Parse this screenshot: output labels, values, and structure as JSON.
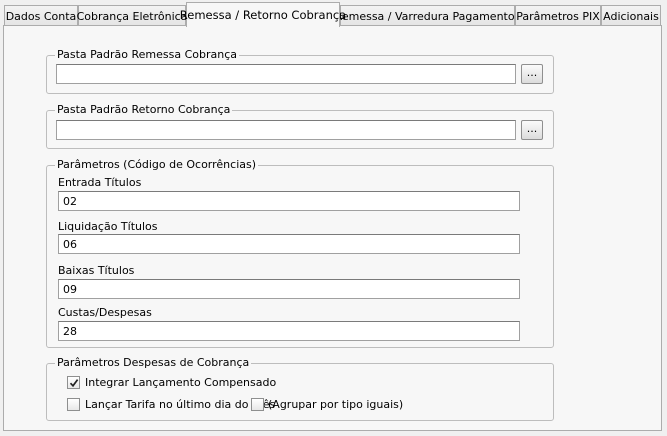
{
  "tabs": [
    {
      "label": "Dados Conta",
      "active": false
    },
    {
      "label": "Cobrança Eletrônica",
      "active": false
    },
    {
      "label": "Remessa / Retorno Cobrança",
      "active": true
    },
    {
      "label": "Remessa / Varredura Pagamentos",
      "active": false
    },
    {
      "label": "Parâmetros PIX",
      "active": false
    },
    {
      "label": "Adicionais",
      "active": false
    }
  ],
  "remessa": {
    "legend": "Pasta Padrão Remessa Cobrança",
    "value": "",
    "browse_label": "..."
  },
  "retorno": {
    "legend": "Pasta Padrão Retorno Cobrança",
    "value": "",
    "browse_label": "..."
  },
  "parametros": {
    "legend": "Parâmetros (Código de Ocorrências)",
    "fields": [
      {
        "label": "Entrada Títulos",
        "value": "02"
      },
      {
        "label": "Liquidação Títulos",
        "value": "06"
      },
      {
        "label": "Baixas Títulos",
        "value": "09"
      },
      {
        "label": "Custas/Despesas",
        "value": "28"
      }
    ]
  },
  "despesas": {
    "legend": "Parâmetros Despesas de Cobrança",
    "integrar": {
      "label": "Integrar Lançamento Compensado",
      "checked": true
    },
    "lancar": {
      "label": "Lançar Tarifa no último dia do mês",
      "checked": false
    },
    "agrupar": {
      "label": "(Agrupar por tipo iguais)",
      "checked": false
    }
  }
}
